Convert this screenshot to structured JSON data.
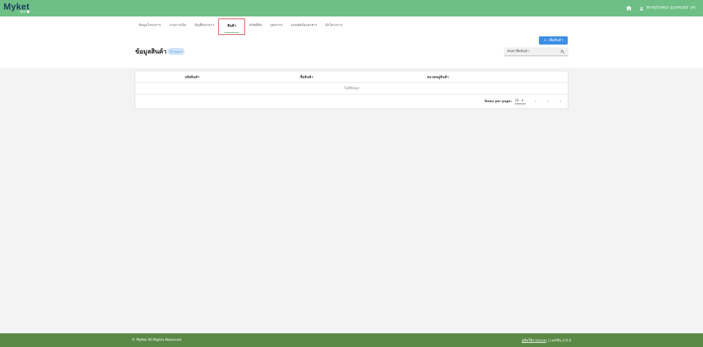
{
  "brand": {
    "logo_main": "Myket",
    "logo_sub": "pro"
  },
  "topbar": {
    "user_label": "MYKETPRO SUPPORT (P)"
  },
  "nav": {
    "items": [
      {
        "label": "ข้อมูลโครงการ"
      },
      {
        "label": "งานการเงิน"
      },
      {
        "label": "บัญชีธนาคาร"
      },
      {
        "label": "สินค้า"
      },
      {
        "label": "ทรัพย์สิน"
      },
      {
        "label": "บุคลากร"
      },
      {
        "label": "แบบฟอร์มเอกสาร"
      },
      {
        "label": "ผังโครงการ"
      }
    ],
    "active_index": 3
  },
  "page": {
    "title": "ข้อมูลสินค้า",
    "badge": "0 รายการ",
    "add_button_label": "เพิ่มสินค้า"
  },
  "search": {
    "placeholder": "ค้นหาชื่อสินค้า"
  },
  "table": {
    "headers": [
      "รหัสสินค้า",
      "ชื่อสินค้า",
      "หมวดหมู่สินค้า"
    ],
    "empty_text": "ไม่มีข้อมูล",
    "rows_per_page_label": "Rows per page:",
    "rows_per_page_value": "10",
    "range_text": "–"
  },
  "footer": {
    "copyright": "© MyKet All Rights Reserved",
    "manual_link": "คู่มือใช้งานระบบ",
    "version": " | เวอร์ชั่น 2.0.0"
  },
  "colors": {
    "topbar": "#6dbf86",
    "footer": "#5a8a46",
    "accent": "#3d8ee6",
    "active_outline": "#d9534f"
  }
}
